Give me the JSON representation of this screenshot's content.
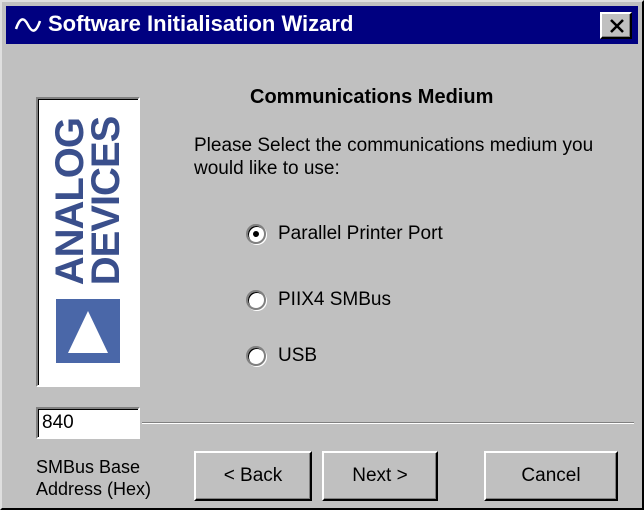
{
  "window": {
    "title": "Software Initialisation Wizard",
    "app_icon": "analog-devices-waveform-icon",
    "close_icon": "close-icon"
  },
  "logo": {
    "line1": "ANALOG",
    "line2": "DEVICES",
    "color": "#3a4f8c"
  },
  "main": {
    "section_title": "Communications Medium",
    "prompt": "Please Select the communications medium you would like to use:",
    "options": [
      {
        "label": "Parallel Printer Port",
        "selected": true
      },
      {
        "label": "PIIX4 SMBus",
        "selected": false
      },
      {
        "label": "USB",
        "selected": false
      }
    ]
  },
  "address": {
    "value": "840",
    "label_line1": "SMBus Base",
    "label_line2": "Address (Hex)"
  },
  "buttons": {
    "back": "< Back",
    "next": "Next >",
    "cancel": "Cancel"
  },
  "colors": {
    "titlebar": "#000080",
    "face": "#c0c0c0",
    "logo_blue": "#4a67a8"
  }
}
